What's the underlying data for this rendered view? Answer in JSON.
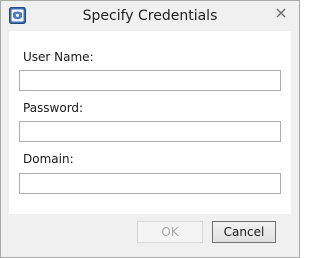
{
  "window": {
    "title": "Specify Credentials",
    "icon": "shield-key-icon",
    "close_icon": "close-icon"
  },
  "form": {
    "user_name": {
      "label": "User Name:",
      "value": "",
      "placeholder": ""
    },
    "password": {
      "label": "Password:",
      "value": "",
      "placeholder": ""
    },
    "domain": {
      "label": "Domain:",
      "value": "",
      "placeholder": ""
    }
  },
  "buttons": {
    "ok_label": "OK",
    "ok_enabled": false,
    "cancel_label": "Cancel"
  },
  "colors": {
    "accent_icon": "#2b5fa8",
    "dialog_bg": "#f0f0f0"
  }
}
